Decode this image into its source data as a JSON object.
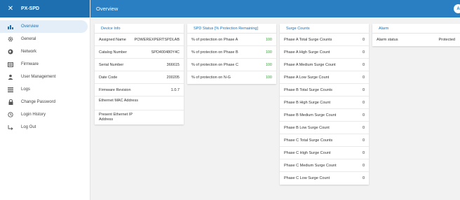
{
  "app": {
    "title": "PX-SPD",
    "close_glyph": "✕"
  },
  "topbar": {
    "title": "Overview",
    "avatar": "A"
  },
  "sidebar": {
    "items": [
      {
        "label": "Overview",
        "icon": "bar-chart-icon",
        "active": true
      },
      {
        "label": "General",
        "icon": "gear-icon"
      },
      {
        "label": "Network",
        "icon": "globe-icon"
      },
      {
        "label": "Firmware",
        "icon": "firmware-icon"
      },
      {
        "label": "User Management",
        "icon": "user-icon"
      },
      {
        "label": "Logs",
        "icon": "list-icon"
      },
      {
        "label": "Change Password",
        "icon": "lock-icon"
      },
      {
        "label": "Login History",
        "icon": "history-icon"
      },
      {
        "label": "Log Out",
        "icon": "logout-icon"
      }
    ]
  },
  "device_info": {
    "title": "Device Info",
    "rows": [
      {
        "label": "Assigned Name",
        "value": "POWEREXPERTSPDLAB"
      },
      {
        "label": "Catalog Number",
        "value": "SPD400480Y4C"
      },
      {
        "label": "Serial Number",
        "value": "366615"
      },
      {
        "label": "Date Code",
        "value": "200205"
      },
      {
        "label": "Firmware Revision",
        "value": "1.0.7"
      },
      {
        "label": "Ethernet MAC Address",
        "value": ""
      },
      {
        "label": "Present Ethernet IP Address",
        "value": ""
      }
    ]
  },
  "spd_status": {
    "title": "SPD Status [% Protection Remaining]",
    "rows": [
      {
        "label": "% of protection on Phase A",
        "value": "100"
      },
      {
        "label": "% of protection on Phase B",
        "value": "100"
      },
      {
        "label": "% of protection on Phase C",
        "value": "100"
      },
      {
        "label": "% of protection on N-G",
        "value": "100"
      }
    ]
  },
  "surge_counts": {
    "title": "Surge Counts",
    "rows": [
      {
        "label": "Phase A Total Surge Counts",
        "value": "0"
      },
      {
        "label": "Phase A High Surge Count",
        "value": "0"
      },
      {
        "label": "Phase A Medium Surge Count",
        "value": "0"
      },
      {
        "label": "Phase A Low Surge Count",
        "value": "0"
      },
      {
        "label": "Phase B Total Surge Counts",
        "value": "0"
      },
      {
        "label": "Phase B High Surge Count",
        "value": "0"
      },
      {
        "label": "Phase B Medium Surge Count",
        "value": "0"
      },
      {
        "label": "Phase B Low Surge Count",
        "value": "0"
      },
      {
        "label": "Phase C Total Surge Counts",
        "value": "0"
      },
      {
        "label": "Phase C High Surge Count",
        "value": "0"
      },
      {
        "label": "Phase C Medium Surge Count",
        "value": "0"
      },
      {
        "label": "Phase C Low Surge Count",
        "value": "0"
      }
    ]
  },
  "alarm": {
    "title": "Alarm",
    "rows": [
      {
        "label": "Alarm status",
        "value": "Protected"
      }
    ]
  },
  "colors": {
    "header": "#2a7fc2",
    "sidebar_header": "#1e6fb0",
    "accent": "#1e6fb0",
    "ok_green": "#3aa53a"
  }
}
